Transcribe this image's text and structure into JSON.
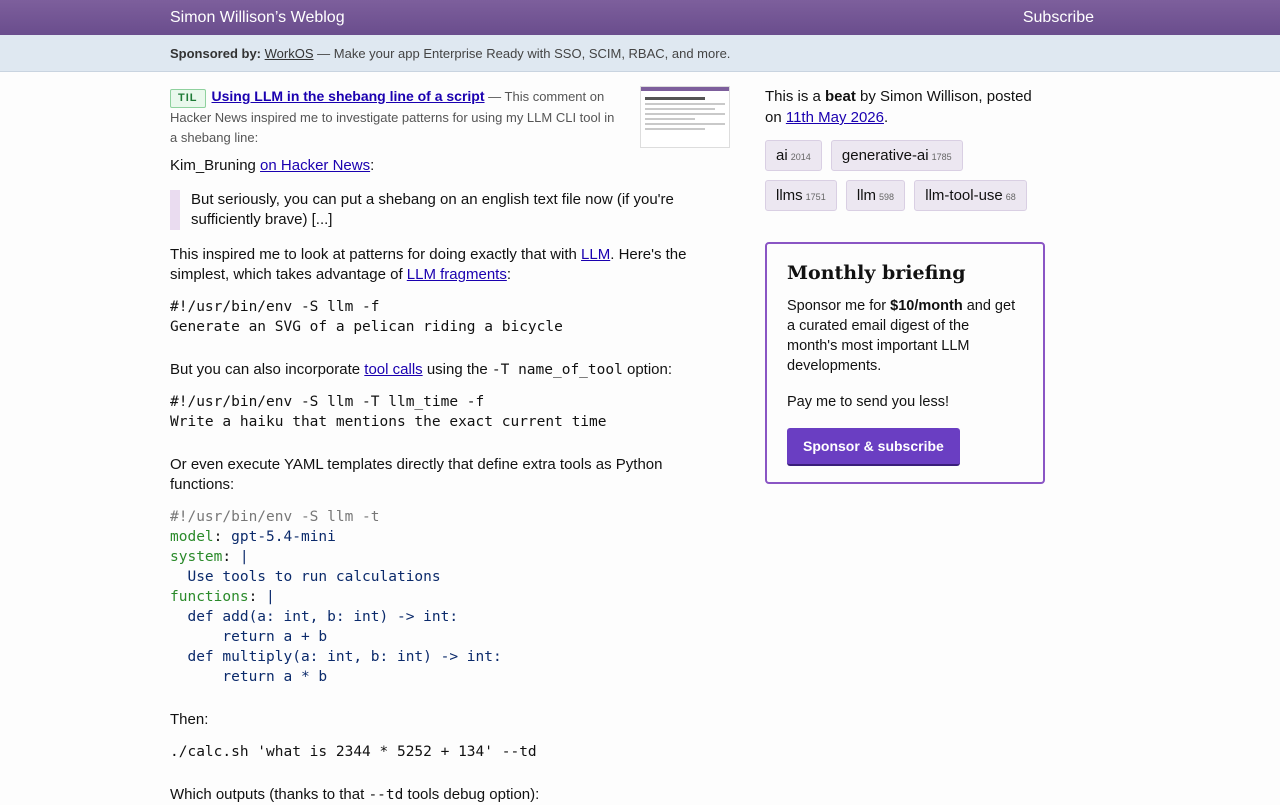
{
  "header": {
    "site_title": "Simon Willison’s Weblog",
    "subscribe": "Subscribe"
  },
  "sponsor": {
    "label": "Sponsored by:",
    "name": "WorkOS",
    "text": " — Make your app Enterprise Ready with SSO, SCIM, RBAC, and more."
  },
  "til": {
    "badge": "TIL",
    "title": "Using LLM in the shebang line of a script",
    "summary": " — This comment on Hacker News inspired me to investigate patterns for using my LLM CLI tool in a shebang line:"
  },
  "post": {
    "attr_name": "Kim_Bruning ",
    "attr_link": "on Hacker News",
    "attr_suffix": ":",
    "quote": "But seriously, you can put a shebang on an english text file now (if you're sufficiently brave) [...]",
    "p1_a": "This inspired me to look at patterns for doing exactly that with ",
    "p1_link1": "LLM",
    "p1_b": ". Here's the simplest, which takes advantage of ",
    "p1_link2": "LLM fragments",
    "p1_c": ":",
    "code1": "#!/usr/bin/env -S llm -f\nGenerate an SVG of a pelican riding a bicycle",
    "p2_a": "But you can also incorporate ",
    "p2_link": "tool calls",
    "p2_b": " using the ",
    "p2_code": "-T name_of_tool",
    "p2_c": " option:",
    "code2": "#!/usr/bin/env -S llm -T llm_time -f\nWrite a haiku that mentions the exact current time",
    "p3": "Or even execute YAML templates directly that define extra tools as Python functions:",
    "yaml": {
      "shebang": "#!/usr/bin/env -S llm -t",
      "model_key": "model",
      "model_val": "gpt-5.4-mini",
      "system_key": "system",
      "system_val": "|",
      "system_body": "  Use tools to run calculations",
      "functions_key": "functions",
      "functions_val": "|",
      "body1": "  def add(a: int, b: int) -> int:",
      "body2": "      return a + b",
      "body3": "  def multiply(a: int, b: int) -> int:",
      "body4": "      return a * b"
    },
    "p4": "Then:",
    "code3": "./calc.sh 'what is 2344 * 5252 + 134' --td",
    "p5_a": "Which outputs (thanks to that ",
    "p5_code": "--td",
    "p5_b": " tools debug option):"
  },
  "sidebar": {
    "beat_a": "This is a ",
    "beat_b": "beat",
    "beat_c": " by Simon Willison, posted on ",
    "date": "11th May 2026",
    "beat_d": ".",
    "tags": [
      {
        "name": "ai",
        "count": "2014"
      },
      {
        "name": "generative-ai",
        "count": "1785"
      },
      {
        "name": "llms",
        "count": "1751"
      },
      {
        "name": "llm",
        "count": "598"
      },
      {
        "name": "llm-tool-use",
        "count": "68"
      }
    ],
    "briefing": {
      "title": "Monthly briefing",
      "text_a": "Sponsor me for ",
      "price": "$10/month",
      "text_b": " and get a curated email digest of the month's most important LLM developments.",
      "text2": "Pay me to send you less!",
      "button": "Sponsor & subscribe"
    }
  }
}
